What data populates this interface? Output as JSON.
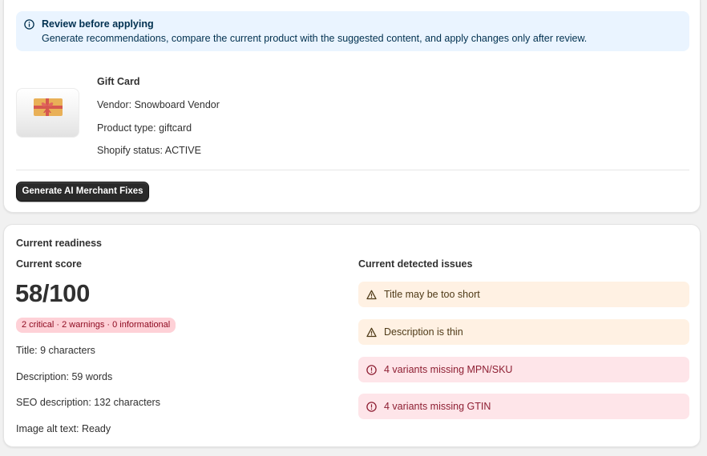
{
  "banner": {
    "icon": "info-icon",
    "title": "Review before applying",
    "text": "Generate recommendations, compare the current product with the suggested content, and apply changes only after review."
  },
  "product": {
    "image_icon": "gift-card-icon",
    "title": "Gift Card",
    "vendor": "Vendor: Snowboard Vendor",
    "type": "Product type: giftcard",
    "status": "Shopify status: ACTIVE"
  },
  "actions": {
    "generate_label": "Generate AI Merchant Fixes"
  },
  "readiness": {
    "section_title": "Current readiness",
    "score_heading": "Current score",
    "score": "58/100",
    "summary_badge": "2 critical · 2 warnings · 0 informational",
    "metrics": [
      "Title: 9 characters",
      "Description: 59 words",
      "SEO description: 132 characters",
      "Image alt text: Ready"
    ],
    "issues_heading": "Current detected issues",
    "issues": [
      {
        "severity": "warning",
        "icon": "alert-triangle-icon",
        "text": "Title may be too short"
      },
      {
        "severity": "warning",
        "icon": "alert-triangle-icon",
        "text": "Description is thin"
      },
      {
        "severity": "critical",
        "icon": "alert-circle-icon",
        "text": "4 variants missing MPN/SKU"
      },
      {
        "severity": "critical",
        "icon": "alert-circle-icon",
        "text": "4 variants missing GTIN"
      }
    ]
  },
  "colors": {
    "banner_bg": "#eaf4ff",
    "warning_bg": "#fff1e3",
    "critical_bg": "#fee5e9",
    "badge_bg": "#fed1d7",
    "primary_button": "#2a2a2a"
  }
}
